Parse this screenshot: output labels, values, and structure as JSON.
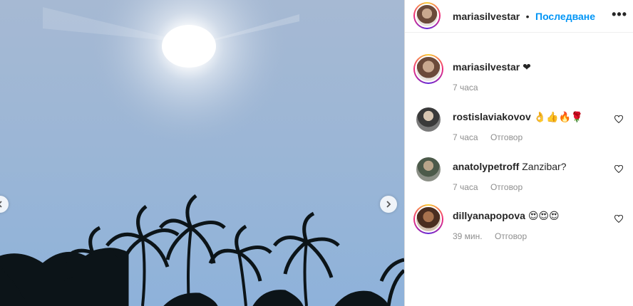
{
  "photo": {
    "prev_icon": "chevron-left-icon",
    "next_icon": "chevron-right-icon"
  },
  "header": {
    "username": "mariasilvestar",
    "separator": "•",
    "follow_label": "Последване",
    "more_icon": "more-options-icon"
  },
  "caption": {
    "username": "mariasilvestar",
    "text": "❤",
    "time": "7 часа"
  },
  "comments": [
    {
      "username": "rostislaviakovov",
      "text": "👌👍🔥🌹",
      "time": "7 часа",
      "reply": "Отговор"
    },
    {
      "username": "anatolypetroff",
      "text": "Zanzibar?",
      "time": "7 часа",
      "reply": "Отговор"
    },
    {
      "username": "dillyanapopova",
      "text": "😍😍😍",
      "time": "39 мин.",
      "reply": "Отговор"
    }
  ],
  "colors": {
    "follow_blue": "#0095f6",
    "meta_gray": "#8e8e8e",
    "sky_top": "#a9bdd6",
    "sky_bottom": "#8fb0d6"
  }
}
